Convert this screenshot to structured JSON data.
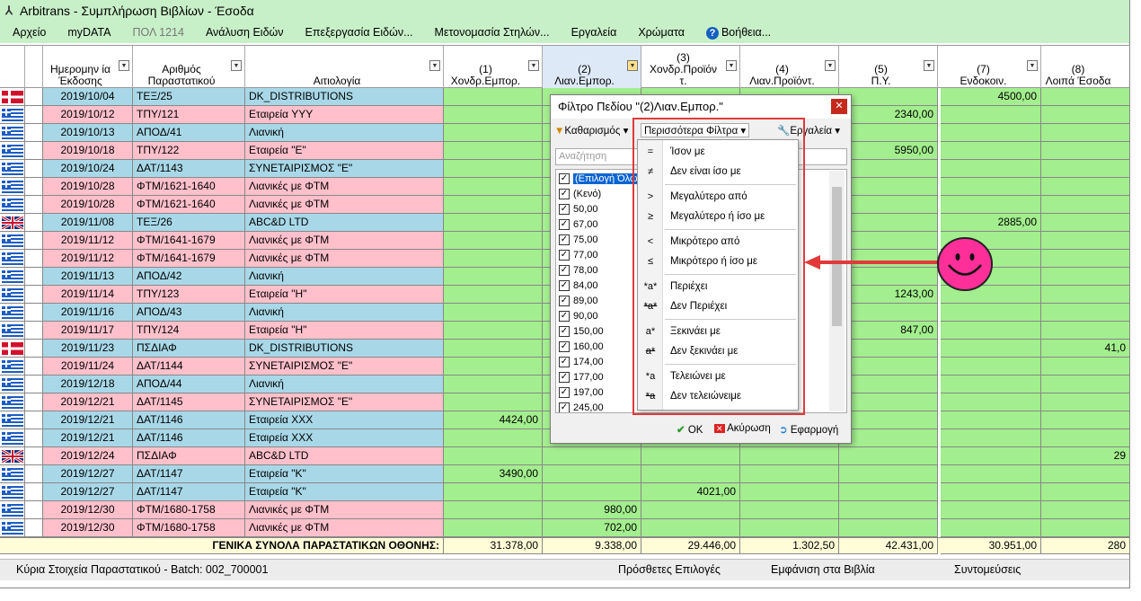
{
  "window": {
    "title": "Arbitrans - Συμπλήρωση Βιβλίων - Έσοδα"
  },
  "menu": [
    {
      "label": "Αρχείο",
      "disabled": false
    },
    {
      "label": "myDATA",
      "disabled": false
    },
    {
      "label": "ΠΟΛ 1214",
      "disabled": true
    },
    {
      "label": "Ανάλυση Ειδών",
      "disabled": false
    },
    {
      "label": "Επεξεργασία Ειδών...",
      "disabled": false
    },
    {
      "label": "Μετονομασία Στηλών...",
      "disabled": false
    },
    {
      "label": "Εργαλεία",
      "disabled": false
    },
    {
      "label": "Χρώματα",
      "disabled": false
    },
    {
      "label": "Βοήθεια...",
      "disabled": false
    }
  ],
  "columns": {
    "date": "Ημερομην ία\nΈκδοσης",
    "number": "Αριθμός\nΠαραστατικού",
    "reason": "Αιτιολογία",
    "c1": "(1)\nΧονδρ.Εμπορ.",
    "c2": "(2)\nΛιαν.Εμπορ.",
    "c3": "(3)\nΧονδρ.Προϊόν\nτ.",
    "c4": "(4)\nΛιαν.Προϊόντ.",
    "c5": "(5)\nΠ.Υ.",
    "c7": "(7)\nΕνδοκοιν.",
    "c8": "(8)\nΛοιπά Έσοδα"
  },
  "rows": [
    {
      "flag": "dk",
      "date": "2019/10/04",
      "number": "ΤΕΞ/25",
      "reason": "DK_DISTRIBUTIONS",
      "c1": "",
      "c2": "",
      "c3": "",
      "c4": "",
      "c5": "",
      "c7": "4500,00",
      "c8": "",
      "color": "blue"
    },
    {
      "flag": "gr",
      "date": "2019/10/12",
      "number": "ΤΠΥ/121",
      "reason": "Εταιρεία YYY",
      "c1": "",
      "c2": "",
      "c3": "",
      "c4": "",
      "c5": "2340,00",
      "c7": "",
      "c8": "",
      "color": "pink"
    },
    {
      "flag": "gr",
      "date": "2019/10/13",
      "number": "ΑΠΟΔ/41",
      "reason": "Λιανική",
      "c1": "",
      "c2": "",
      "c3": "",
      "c4": "",
      "c5": "",
      "c7": "",
      "c8": "",
      "color": "blue"
    },
    {
      "flag": "gr",
      "date": "2019/10/18",
      "number": "ΤΠΥ/122",
      "reason": "Εταιρεία \"Ε\"",
      "c1": "",
      "c2": "",
      "c3": "",
      "c4": "",
      "c5": "5950,00",
      "c7": "",
      "c8": "",
      "color": "pink"
    },
    {
      "flag": "gr",
      "date": "2019/10/24",
      "number": "ΔΑΤ/1143",
      "reason": "ΣΥΝΕΤΑΙΡΙΣΜΟΣ \"Ε\"",
      "c1": "",
      "c2": "",
      "c3": "",
      "c4": "",
      "c5": "",
      "c7": "",
      "c8": "",
      "color": "blue"
    },
    {
      "flag": "gr",
      "date": "2019/10/28",
      "number": "ΦΤΜ/1621-1640",
      "reason": "Λιανικές με ΦΤΜ",
      "c1": "",
      "c2": "",
      "c3": "",
      "c4": "",
      "c5": "",
      "c7": "",
      "c8": "",
      "color": "pink"
    },
    {
      "flag": "gr",
      "date": "2019/10/28",
      "number": "ΦΤΜ/1621-1640",
      "reason": "Λιανικές με ΦΤΜ",
      "c1": "",
      "c2": "",
      "c3": "",
      "c4": "",
      "c5": "",
      "c7": "",
      "c8": "",
      "color": "pink"
    },
    {
      "flag": "uk",
      "date": "2019/11/08",
      "number": "ΤΕΞ/26",
      "reason": "ABC&D LTD",
      "c1": "",
      "c2": "",
      "c3": "",
      "c4": "",
      "c5": "",
      "c7": "2885,00",
      "c8": "",
      "color": "blue"
    },
    {
      "flag": "gr",
      "date": "2019/11/12",
      "number": "ΦΤΜ/1641-1679",
      "reason": "Λιανικές με ΦΤΜ",
      "c1": "",
      "c2": "",
      "c3": "",
      "c4": "",
      "c5": "",
      "c7": "",
      "c8": "",
      "color": "pink"
    },
    {
      "flag": "gr",
      "date": "2019/11/12",
      "number": "ΦΤΜ/1641-1679",
      "reason": "Λιανικές με ΦΤΜ",
      "c1": "",
      "c2": "",
      "c3": "",
      "c4": "",
      "c5": "",
      "c7": "",
      "c8": "",
      "color": "pink"
    },
    {
      "flag": "gr",
      "date": "2019/11/13",
      "number": "ΑΠΟΔ/42",
      "reason": "Λιανική",
      "c1": "",
      "c2": "",
      "c3": "",
      "c4": "",
      "c5": "",
      "c7": "",
      "c8": "",
      "color": "blue"
    },
    {
      "flag": "gr",
      "date": "2019/11/14",
      "number": "ΤΠΥ/123",
      "reason": "Εταιρεία \"Η\"",
      "c1": "",
      "c2": "",
      "c3": "",
      "c4": "",
      "c5": "1243,00",
      "c7": "",
      "c8": "",
      "color": "pink"
    },
    {
      "flag": "gr",
      "date": "2019/11/16",
      "number": "ΑΠΟΔ/43",
      "reason": "Λιανική",
      "c1": "",
      "c2": "",
      "c3": "",
      "c4": "",
      "c5": "",
      "c7": "",
      "c8": "",
      "color": "blue"
    },
    {
      "flag": "gr",
      "date": "2019/11/17",
      "number": "ΤΠΥ/124",
      "reason": "Εταιρεία \"Η\"",
      "c1": "",
      "c2": "",
      "c3": "",
      "c4": "",
      "c5": "847,00",
      "c7": "",
      "c8": "",
      "color": "pink"
    },
    {
      "flag": "dk",
      "date": "2019/11/23",
      "number": "ΠΣΔΙΑΦ",
      "reason": "DK_DISTRIBUTIONS",
      "c1": "",
      "c2": "",
      "c3": "",
      "c4": "",
      "c5": "",
      "c7": "",
      "c8": "41,0",
      "color": "blue"
    },
    {
      "flag": "gr",
      "date": "2019/11/24",
      "number": "ΔΑΤ/1144",
      "reason": "ΣΥΝΕΤΑΙΡΙΣΜΟΣ \"Ε\"",
      "c1": "",
      "c2": "",
      "c3": "",
      "c4": "",
      "c5": "",
      "c7": "",
      "c8": "",
      "color": "pink"
    },
    {
      "flag": "gr",
      "date": "2019/12/18",
      "number": "ΑΠΟΔ/44",
      "reason": "Λιανική",
      "c1": "",
      "c2": "",
      "c3": "",
      "c4": "",
      "c5": "",
      "c7": "",
      "c8": "",
      "color": "blue"
    },
    {
      "flag": "gr",
      "date": "2019/12/21",
      "number": "ΔΑΤ/1145",
      "reason": "ΣΥΝΕΤΑΙΡΙΣΜΟΣ \"Ε\"",
      "c1": "",
      "c2": "",
      "c3": "",
      "c4": "",
      "c5": "",
      "c7": "",
      "c8": "",
      "color": "pink"
    },
    {
      "flag": "gr",
      "date": "2019/12/21",
      "number": "ΔΑΤ/1146",
      "reason": "Εταιρεία XXX",
      "c1": "4424,00",
      "c2": "",
      "c3": "",
      "c4": "",
      "c5": "",
      "c7": "",
      "c8": "",
      "color": "blue"
    },
    {
      "flag": "gr",
      "date": "2019/12/21",
      "number": "ΔΑΤ/1146",
      "reason": "Εταιρεία XXX",
      "c1": "",
      "c2": "",
      "c3": "",
      "c4": "",
      "c5": "",
      "c7": "",
      "c8": "",
      "color": "blue"
    },
    {
      "flag": "uk",
      "date": "2019/12/24",
      "number": "ΠΣΔΙΑΦ",
      "reason": "ABC&D LTD",
      "c1": "",
      "c2": "",
      "c3": "",
      "c4": "",
      "c5": "",
      "c7": "",
      "c8": "29",
      "color": "pink"
    },
    {
      "flag": "gr",
      "date": "2019/12/27",
      "number": "ΔΑΤ/1147",
      "reason": "Εταιρεία \"Κ\"",
      "c1": "3490,00",
      "c2": "",
      "c3": "",
      "c4": "",
      "c5": "",
      "c7": "",
      "c8": "",
      "color": "blue"
    },
    {
      "flag": "gr",
      "date": "2019/12/27",
      "number": "ΔΑΤ/1147",
      "reason": "Εταιρεία \"Κ\"",
      "c1": "",
      "c2": "",
      "c3": "4021,00",
      "c4": "",
      "c5": "",
      "c7": "",
      "c8": "",
      "color": "blue"
    },
    {
      "flag": "gr",
      "date": "2019/12/30",
      "number": "ΦΤΜ/1680-1758",
      "reason": "Λιανικές με ΦΤΜ",
      "c1": "",
      "c2": "980,00",
      "c3": "",
      "c4": "",
      "c5": "",
      "c7": "",
      "c8": "",
      "color": "pink"
    },
    {
      "flag": "gr",
      "date": "2019/12/30",
      "number": "ΦΤΜ/1680-1758",
      "reason": "Λιανικές με ΦΤΜ",
      "c1": "",
      "c2": "702,00",
      "c3": "",
      "c4": "",
      "c5": "",
      "c7": "",
      "c8": "",
      "color": "pink"
    }
  ],
  "totals": {
    "label": "ΓΕΝΙΚΑ ΣΥΝΟΛΑ ΠΑΡΑΣΤΑΤΙΚΩΝ ΟΘΟΝΗΣ:",
    "c1": "31.378,00",
    "c2": "9.338,00",
    "c3": "29.446,00",
    "c4": "1.302,50",
    "c5": "42.431,00",
    "c7": "30.951,00",
    "c8": "280"
  },
  "status": {
    "main": "Κύρια Στοιχεία Παραστατικού - Batch: 002_700001",
    "extra": "Πρόσθετες Επιλογές",
    "books": "Εμφάνιση στα Βιβλία",
    "shortcuts": "Συντομεύσεις"
  },
  "filter_dialog": {
    "title": "Φίλτρο Πεδίου \"(2)Λιαν.Εμπορ.\"",
    "clear_label": "Καθαρισμός",
    "more_filters_label": "Περισσότερα Φίλτρα",
    "tools_label": "Εργαλεία",
    "search_placeholder": "Αναζήτηση",
    "values": [
      {
        "label": "(Επιλογή Όλων)",
        "checked": true
      },
      {
        "label": "(Κενό)",
        "checked": true
      },
      {
        "label": "50,00",
        "checked": true
      },
      {
        "label": "67,00",
        "checked": true
      },
      {
        "label": "75,00",
        "checked": true
      },
      {
        "label": "77,00",
        "checked": true
      },
      {
        "label": "78,00",
        "checked": true
      },
      {
        "label": "84,00",
        "checked": true
      },
      {
        "label": "89,00",
        "checked": true
      },
      {
        "label": "90,00",
        "checked": true
      },
      {
        "label": "150,00",
        "checked": true
      },
      {
        "label": "160,00",
        "checked": true
      },
      {
        "label": "174,00",
        "checked": true
      },
      {
        "label": "177,00",
        "checked": true
      },
      {
        "label": "197,00",
        "checked": true
      },
      {
        "label": "245,00",
        "checked": true
      }
    ],
    "ok_label": "OK",
    "cancel_label": "Ακύρωση",
    "apply_label": "Εφαρμογή"
  },
  "more_filters_menu": [
    {
      "icon": "=",
      "label": "Ίσον με"
    },
    {
      "icon": "≠",
      "label": "Δεν είναι ίσο με"
    },
    {
      "icon": ">",
      "label": "Μεγαλύτερο από"
    },
    {
      "icon": "≥",
      "label": "Μεγαλύτερο ή ίσο με"
    },
    {
      "icon": "<",
      "label": "Μικρότερο από"
    },
    {
      "icon": "≤",
      "label": "Μικρότερο ή ίσο με"
    },
    {
      "icon": "*a*",
      "label": "Περιέχει"
    },
    {
      "icon": "*a*",
      "label": "Δεν Περιέχει"
    },
    {
      "icon": "a*",
      "label": "Ξεκινάει με"
    },
    {
      "icon": "a*",
      "label": "Δεν ξεκινάει με"
    },
    {
      "icon": "*a",
      "label": "Τελειώνει με"
    },
    {
      "icon": "*a",
      "label": "Δεν τελειώνειμε"
    }
  ],
  "colors": {
    "row_blue": "#a8d8e8",
    "row_pink": "#ffc0cb",
    "num_green": "#a3ee8e",
    "highlight_red": "#e03a3a",
    "smiley_pink": "#ff2f9a"
  }
}
